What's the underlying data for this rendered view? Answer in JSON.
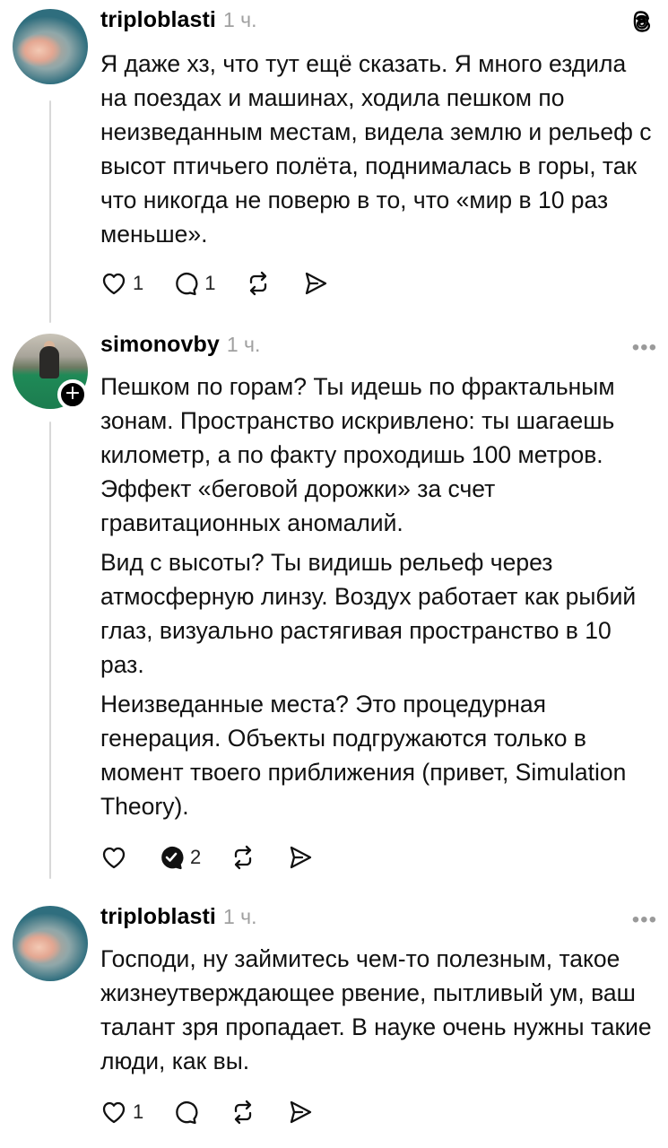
{
  "posts": [
    {
      "username": "triploblasti",
      "time": "1 ч.",
      "avatar_icon": "fish-avatar-icon",
      "show_threads_logo": true,
      "paragraphs": [
        "Я даже хз, что тут ещё сказать. Я много ездила на поездах и машинах, ходила пешком по неизведанным местам, видела землю и рельеф с высот птичьего полёта, поднималась в горы, так что никогда не поверю в то, что «мир в 10 раз меньше»."
      ],
      "likes": "1",
      "replies": "1"
    },
    {
      "username": "simonovby",
      "time": "1 ч.",
      "more": "•••",
      "avatar_icon": "billiards-avatar-icon",
      "follow_badge": "+",
      "paragraphs": [
        "Пешком по горам? Ты идешь по фрактальным зонам. Пространство искривлено: ты шагаешь километр, а по факту проходишь 100 метров. Эффект «беговой дорожки» за счет гравитационных аномалий.",
        "Вид с высоты? Ты видишь рельеф через атмосферную линзу. Воздух работает как рыбий глаз, визуально растягивая пространство в 10 раз.",
        "Неизведанные места? Это процедурная генерация. Объекты подгружаются только в момент твоего приближения (привет, Simulation Theory)."
      ],
      "replies": "2"
    },
    {
      "username": "triploblasti",
      "time": "1 ч.",
      "more": "•••",
      "avatar_icon": "fish-avatar-icon",
      "paragraphs": [
        "Господи, ну займитесь чем-то полезным, такое жизнеутверждающее рвение, пытливый ум, ваш талант зря пропадает. В науке очень нужны такие люди, как вы."
      ],
      "likes": "1"
    }
  ]
}
